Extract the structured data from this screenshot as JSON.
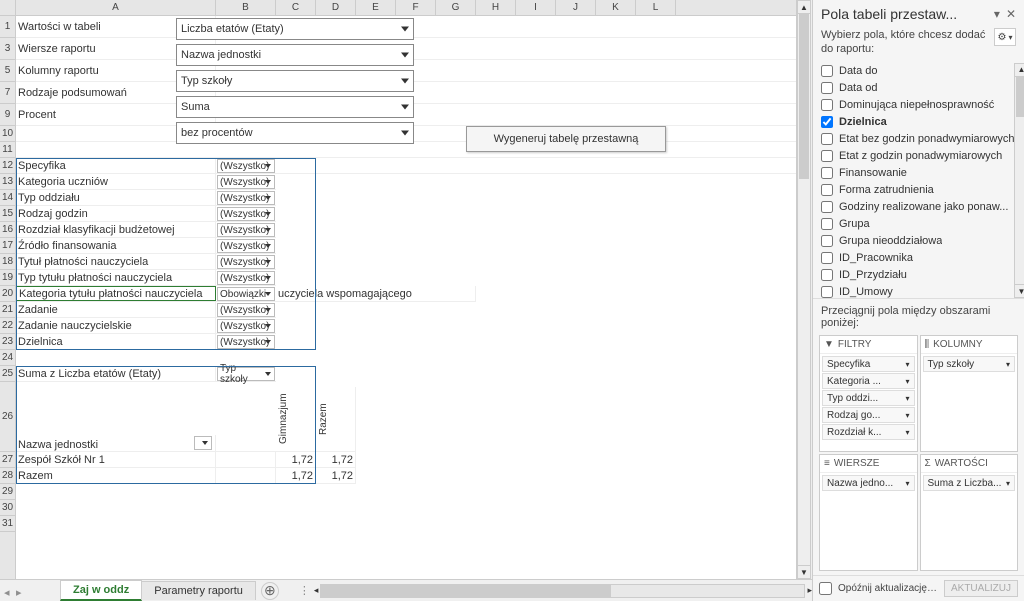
{
  "cols": [
    "A",
    "B",
    "C",
    "D",
    "E",
    "F",
    "G",
    "H",
    "I",
    "J",
    "K",
    "L"
  ],
  "controls": {
    "wart_label": "Wartości w tabeli",
    "wart_value": "Liczba etatów (Etaty)",
    "wiersze_label": "Wiersze raportu",
    "wiersze_value": "Nazwa jednostki",
    "kolumny_label": "Kolumny raportu",
    "kolumny_value": "Typ szkoły",
    "rodzaje_label": "Rodzaje podsumowań",
    "rodzaje_value": "Suma",
    "procent_label": "Procent",
    "procent_value": "bez procentów",
    "generate_btn": "Wygeneruj tabelę przestawną"
  },
  "filters": [
    {
      "row": "12",
      "label": "Specyfika",
      "val": "(Wszystko)"
    },
    {
      "row": "13",
      "label": "Kategoria uczniów",
      "val": "(Wszystko)"
    },
    {
      "row": "14",
      "label": "Typ oddziału",
      "val": "(Wszystko)"
    },
    {
      "row": "15",
      "label": "Rodzaj godzin",
      "val": "(Wszystko)"
    },
    {
      "row": "16",
      "label": "Rozdział klasyfikacji budżetowej",
      "val": "(Wszystko)"
    },
    {
      "row": "17",
      "label": "Źródło finansowania",
      "val": "(Wszystko)"
    },
    {
      "row": "18",
      "label": "Tytuł płatności nauczyciela",
      "val": "(Wszystko)"
    },
    {
      "row": "19",
      "label": "Typ tytułu płatności nauczyciela",
      "val": "(Wszystko)"
    },
    {
      "row": "20",
      "label": "Kategoria tytułu płatności nauczyciela",
      "val": "Obowiązki",
      "extra": "uczyciela wspomagającego"
    },
    {
      "row": "21",
      "label": "Zadanie",
      "val": "(Wszystko)"
    },
    {
      "row": "22",
      "label": "Zadanie nauczycielskie",
      "val": "(Wszystko)"
    },
    {
      "row": "23",
      "label": "Dzielnica",
      "val": "(Wszystko)"
    }
  ],
  "r25": {
    "a": "Suma z Liczba etatów (Etaty)",
    "b": "Typ szkoły"
  },
  "r26": {
    "a": "Nazwa jednostki",
    "c_vert": "Gimnazjum",
    "d_vert": "Razem"
  },
  "data_rows": [
    {
      "row": "27",
      "a": "Zespół Szkół Nr 1",
      "c": "1,72",
      "d": "1,72"
    },
    {
      "row": "28",
      "a": "Razem",
      "c": "1,72",
      "d": "1,72"
    }
  ],
  "tabs": {
    "active": "Zaj w oddz",
    "other": "Parametry raportu"
  },
  "pane": {
    "title": "Pola tabeli przestaw...",
    "sub": "Wybierz pola, które chcesz dodać do raportu:",
    "fields": [
      {
        "label": "Data do",
        "checked": false
      },
      {
        "label": "Data od",
        "checked": false
      },
      {
        "label": "Dominująca niepełnosprawność",
        "checked": false
      },
      {
        "label": "Dzielnica",
        "checked": true,
        "bold": true
      },
      {
        "label": "Etat bez godzin ponadwymiarowych",
        "checked": false
      },
      {
        "label": "Etat z godzin ponadwymiarowych",
        "checked": false
      },
      {
        "label": "Finansowanie",
        "checked": false
      },
      {
        "label": "Forma zatrudnienia",
        "checked": false
      },
      {
        "label": "Godziny realizowane jako ponaw...",
        "checked": false
      },
      {
        "label": "Grupa",
        "checked": false
      },
      {
        "label": "Grupa nieoddziałowa",
        "checked": false
      },
      {
        "label": "ID_Pracownika",
        "checked": false
      },
      {
        "label": "ID_Przydziału",
        "checked": false
      },
      {
        "label": "ID_Umowy",
        "checked": false
      }
    ],
    "drag_hint": "Przeciągnij pola między obszarami poniżej:",
    "boxes": {
      "filtry": {
        "hdr": "FILTRY",
        "items": [
          "Specyfika",
          "Kategoria ...",
          "Typ oddzi...",
          "Rodzaj go...",
          "Rozdział k..."
        ]
      },
      "kolumny": {
        "hdr": "KOLUMNY",
        "items": [
          "Typ szkoły"
        ]
      },
      "wiersze": {
        "hdr": "WIERSZE",
        "items": [
          "Nazwa jedno..."
        ]
      },
      "wartosci": {
        "hdr": "WARTOŚCI",
        "items": [
          "Suma z Liczba..."
        ]
      }
    },
    "defer": "Opóźnij aktualizację u...",
    "update": "AKTUALIZUJ"
  },
  "chart_data": {
    "type": "table",
    "title": "Suma z Liczba etatów (Etaty) by Nazwa jednostki × Typ szkoły",
    "columns": [
      "Nazwa jednostki",
      "Gimnazjum",
      "Razem"
    ],
    "rows": [
      [
        "Zespół Szkół Nr 1",
        1.72,
        1.72
      ],
      [
        "Razem",
        1.72,
        1.72
      ]
    ]
  }
}
